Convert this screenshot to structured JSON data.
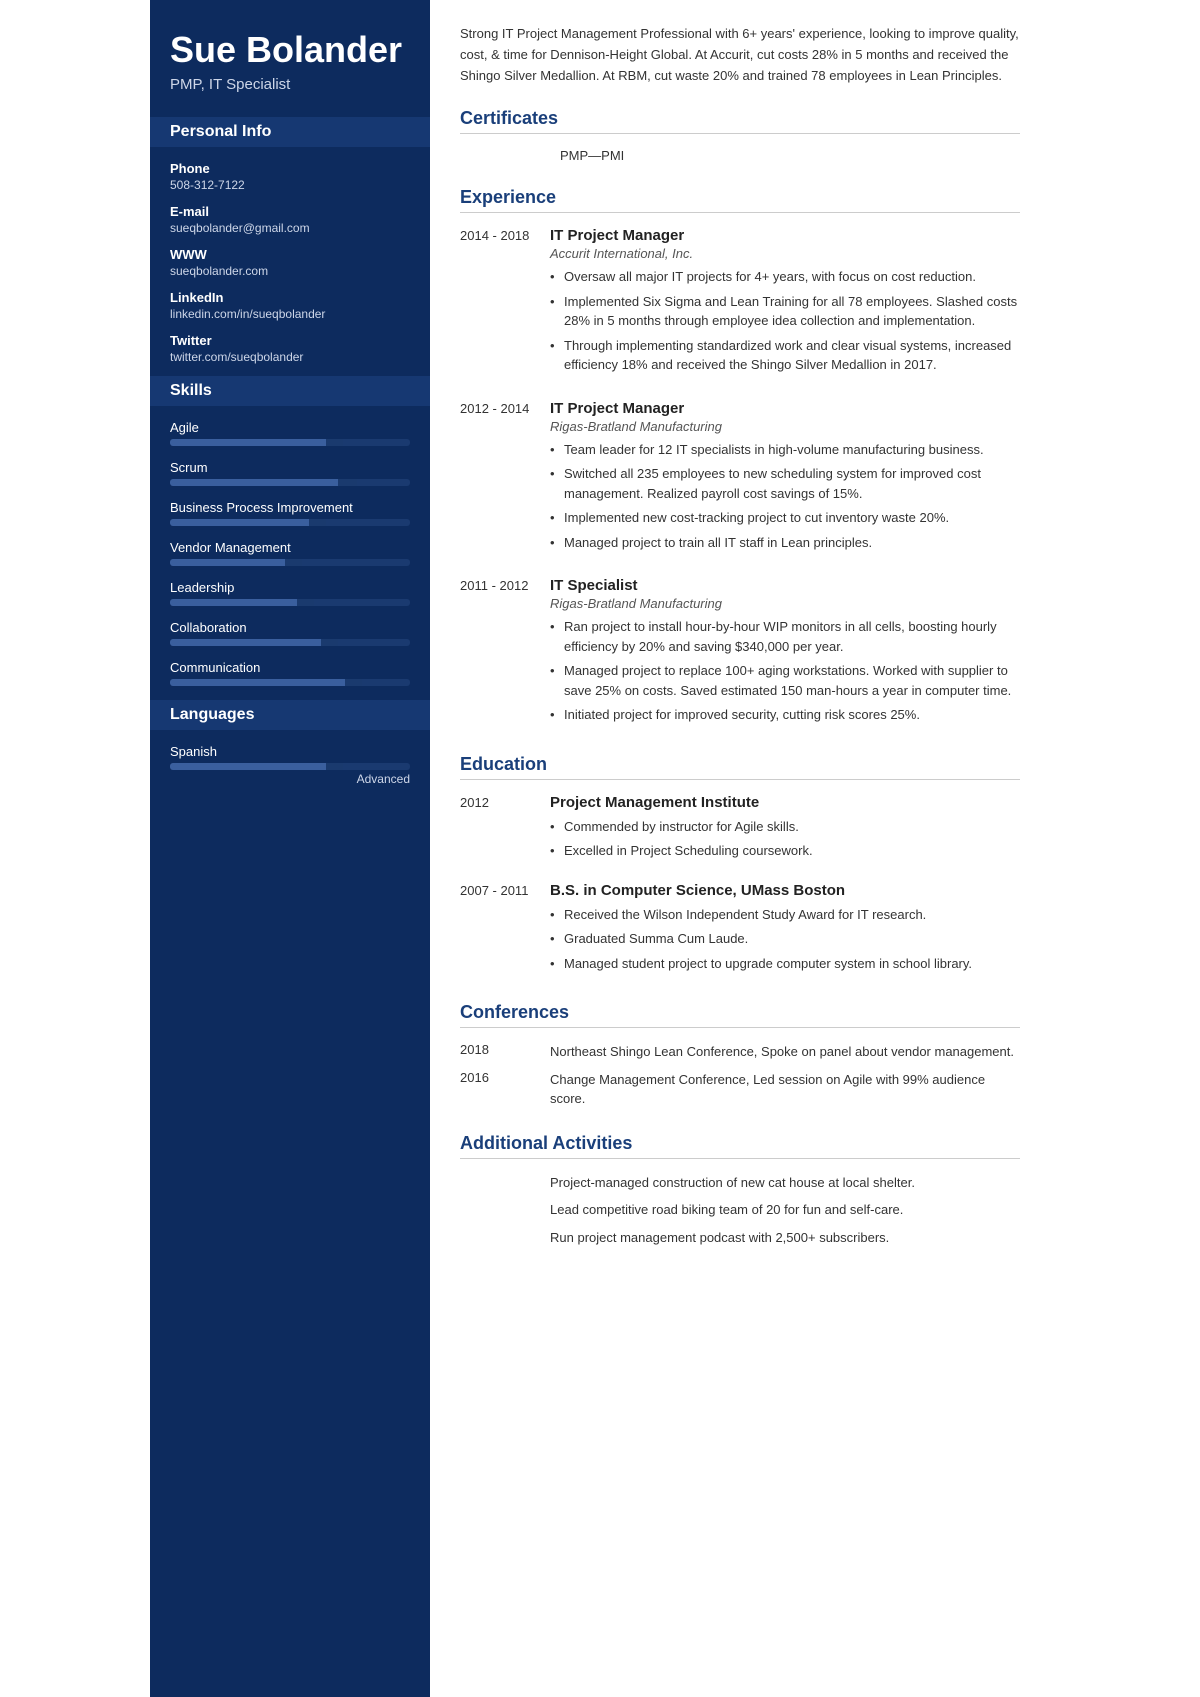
{
  "sidebar": {
    "name": "Sue Bolander",
    "title": "PMP, IT Specialist",
    "personal_info_label": "Personal Info",
    "phone_label": "Phone",
    "phone": "508-312-7122",
    "email_label": "E-mail",
    "email": "sueqbolander@gmail.com",
    "www_label": "WWW",
    "www": "sueqbolander.com",
    "linkedin_label": "LinkedIn",
    "linkedin": "linkedin.com/in/sueqbolander",
    "twitter_label": "Twitter",
    "twitter": "twitter.com/sueqbolander",
    "skills_label": "Skills",
    "skills": [
      {
        "name": "Agile",
        "bar_pct": 72,
        "accent_start": 65,
        "accent_width": 7
      },
      {
        "name": "Scrum",
        "bar_pct": 78,
        "accent_start": 70,
        "accent_width": 8
      },
      {
        "name": "Business Process Improvement",
        "bar_pct": 65,
        "accent_start": 58,
        "accent_width": 7
      },
      {
        "name": "Vendor Management",
        "bar_pct": 55,
        "accent_start": 48,
        "accent_width": 7
      },
      {
        "name": "Leadership",
        "bar_pct": 60,
        "accent_start": 53,
        "accent_width": 7
      },
      {
        "name": "Collaboration",
        "bar_pct": 70,
        "accent_start": 63,
        "accent_width": 7
      },
      {
        "name": "Communication",
        "bar_pct": 80,
        "accent_start": 73,
        "accent_width": 7
      }
    ],
    "languages_label": "Languages",
    "languages": [
      {
        "name": "Spanish",
        "level": "Advanced",
        "bar_pct": 72,
        "accent_start": 65,
        "accent_width": 7
      }
    ]
  },
  "main": {
    "summary": "Strong IT Project Management Professional with 6+ years' experience, looking to improve quality, cost, & time for Dennison-Height Global. At Accurit, cut costs 28% in 5 months and received the Shingo Silver Medallion. At RBM, cut waste 20% and trained 78 employees in Lean Principles.",
    "certificates_label": "Certificates",
    "certificates": [
      {
        "value": "PMP—PMI"
      }
    ],
    "experience_label": "Experience",
    "experience": [
      {
        "dates": "2014 - 2018",
        "title": "IT Project Manager",
        "company": "Accurit International, Inc.",
        "bullets": [
          "Oversaw all major IT projects for 4+ years, with focus on cost reduction.",
          "Implemented Six Sigma and Lean Training for all 78 employees. Slashed costs 28% in 5 months through employee idea collection and implementation.",
          "Through implementing standardized work and clear visual systems, increased efficiency 18% and received the Shingo Silver Medallion in 2017."
        ]
      },
      {
        "dates": "2012 - 2014",
        "title": "IT Project Manager",
        "company": "Rigas-Bratland Manufacturing",
        "bullets": [
          "Team leader for 12 IT specialists in high-volume manufacturing business.",
          "Switched all 235 employees to new scheduling system for improved cost management. Realized payroll cost savings of 15%.",
          "Implemented new cost-tracking project to cut inventory waste 20%.",
          "Managed project to train all IT staff in Lean principles."
        ]
      },
      {
        "dates": "2011 - 2012",
        "title": "IT Specialist",
        "company": "Rigas-Bratland Manufacturing",
        "bullets": [
          "Ran project to install hour-by-hour WIP monitors in all cells, boosting hourly efficiency by 20% and saving $340,000 per year.",
          "Managed project to replace 100+ aging workstations. Worked with supplier to save 25% on costs. Saved estimated 150 man-hours a year in computer time.",
          "Initiated project for improved security, cutting risk scores 25%."
        ]
      }
    ],
    "education_label": "Education",
    "education": [
      {
        "dates": "2012",
        "title": "Project Management Institute",
        "bullets": [
          "Commended by instructor for Agile skills.",
          "Excelled in Project Scheduling coursework."
        ]
      },
      {
        "dates": "2007 - 2011",
        "title": "B.S. in Computer Science, UMass Boston",
        "bullets": [
          "Received the Wilson Independent Study Award for IT research.",
          "Graduated Summa Cum Laude.",
          "Managed student project to upgrade computer system in school library."
        ]
      }
    ],
    "conferences_label": "Conferences",
    "conferences": [
      {
        "year": "2018",
        "desc": "Northeast Shingo Lean Conference, Spoke on panel about vendor management."
      },
      {
        "year": "2016",
        "desc": "Change Management Conference, Led session on Agile with 99% audience score."
      }
    ],
    "activities_label": "Additional Activities",
    "activities": [
      "Project-managed construction of new cat house at local shelter.",
      "Lead competitive road biking team of 20 for fun and self-care.",
      "Run project management podcast with 2,500+ subscribers."
    ]
  }
}
